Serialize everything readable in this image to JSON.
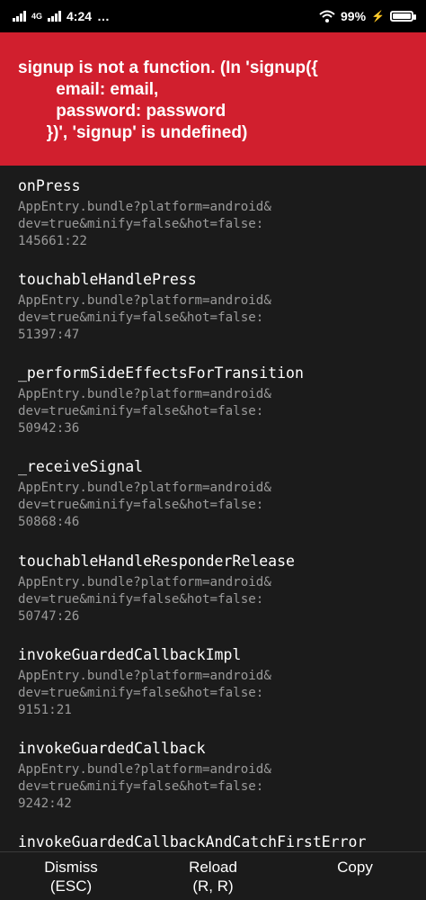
{
  "status_bar": {
    "net_type": "4G",
    "time": "4:24",
    "more": "…",
    "battery": "99%"
  },
  "error": {
    "message": "signup is not a function. (In 'signup({\n        email: email,\n        password: password\n      })', 'signup' is undefined)"
  },
  "stack": [
    {
      "method": "onPress",
      "location": "AppEntry.bundle?platform=android&\ndev=true&minify=false&hot=false:\n145661:22"
    },
    {
      "method": "touchableHandlePress",
      "location": "AppEntry.bundle?platform=android&\ndev=true&minify=false&hot=false:\n51397:47"
    },
    {
      "method": "_performSideEffectsForTransition",
      "location": "AppEntry.bundle?platform=android&\ndev=true&minify=false&hot=false:\n50942:36"
    },
    {
      "method": "_receiveSignal",
      "location": "AppEntry.bundle?platform=android&\ndev=true&minify=false&hot=false:\n50868:46"
    },
    {
      "method": "touchableHandleResponderRelease",
      "location": "AppEntry.bundle?platform=android&\ndev=true&minify=false&hot=false:\n50747:26"
    },
    {
      "method": "invokeGuardedCallbackImpl",
      "location": "AppEntry.bundle?platform=android&\ndev=true&minify=false&hot=false:\n9151:21"
    },
    {
      "method": "invokeGuardedCallback",
      "location": "AppEntry.bundle?platform=android&\ndev=true&minify=false&hot=false:\n9242:42"
    },
    {
      "method": "invokeGuardedCallbackAndCatchFirstError",
      "location": ""
    }
  ],
  "footer": {
    "dismiss": {
      "label": "Dismiss",
      "sub": "(ESC)"
    },
    "reload": {
      "label": "Reload",
      "sub": "(R, R)"
    },
    "copy": {
      "label": "Copy"
    }
  },
  "colors": {
    "header_bg": "#d11f2e",
    "body_bg": "#1b1b1b",
    "secondary_text": "#9a9a9a"
  }
}
